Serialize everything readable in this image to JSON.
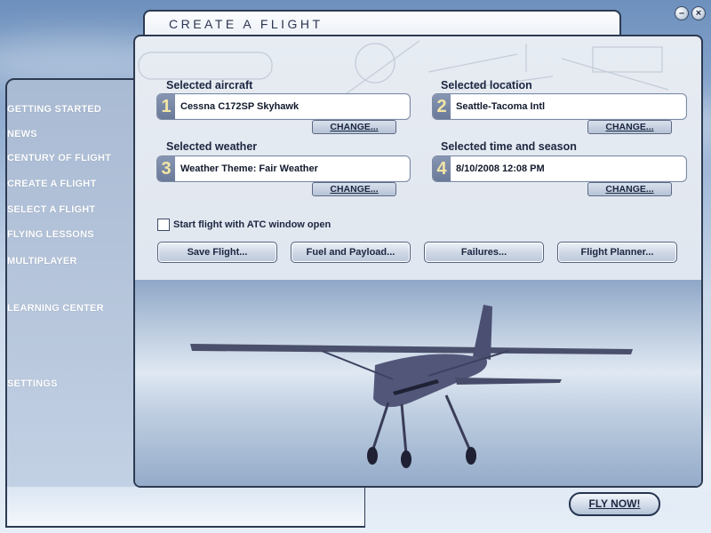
{
  "window": {
    "title": "CREATE A FLIGHT",
    "minimize_icon": "minimize-icon",
    "close_icon": "close-icon",
    "minimize_glyph": "–",
    "close_glyph": "×"
  },
  "sidebar": {
    "items": [
      {
        "label": "GETTING STARTED"
      },
      {
        "label": "NEWS"
      },
      {
        "label": "CENTURY OF FLIGHT"
      },
      {
        "label": "CREATE A FLIGHT"
      },
      {
        "label": "SELECT A FLIGHT"
      },
      {
        "label": "FLYING LESSONS"
      },
      {
        "label": "MULTIPLAYER"
      },
      {
        "label": "LEARNING CENTER"
      },
      {
        "label": "SETTINGS"
      }
    ]
  },
  "sections": {
    "aircraft": {
      "number": "1",
      "label": "Selected aircraft",
      "value": "Cessna C172SP Skyhawk",
      "button": "CHANGE..."
    },
    "location": {
      "number": "2",
      "label": "Selected location",
      "value": "Seattle-Tacoma Intl",
      "button": "CHANGE..."
    },
    "weather": {
      "number": "3",
      "label": "Selected weather",
      "value": "Weather Theme: Fair Weather",
      "button": "CHANGE..."
    },
    "time": {
      "number": "4",
      "label": "Selected time and season",
      "value": "8/10/2008 12:08 PM",
      "button": "CHANGE..."
    }
  },
  "atc_checkbox": {
    "label": "Start flight with ATC window open",
    "checked": false
  },
  "actions": {
    "save": "Save Flight...",
    "fuel": "Fuel and Payload...",
    "failures": "Failures...",
    "planner": "Flight Planner..."
  },
  "fly_now": "FLY NOW!",
  "colors": {
    "panel_border": "#2c3a52",
    "number_badge": "#7788a6",
    "number_text": "#f2e6a6"
  }
}
